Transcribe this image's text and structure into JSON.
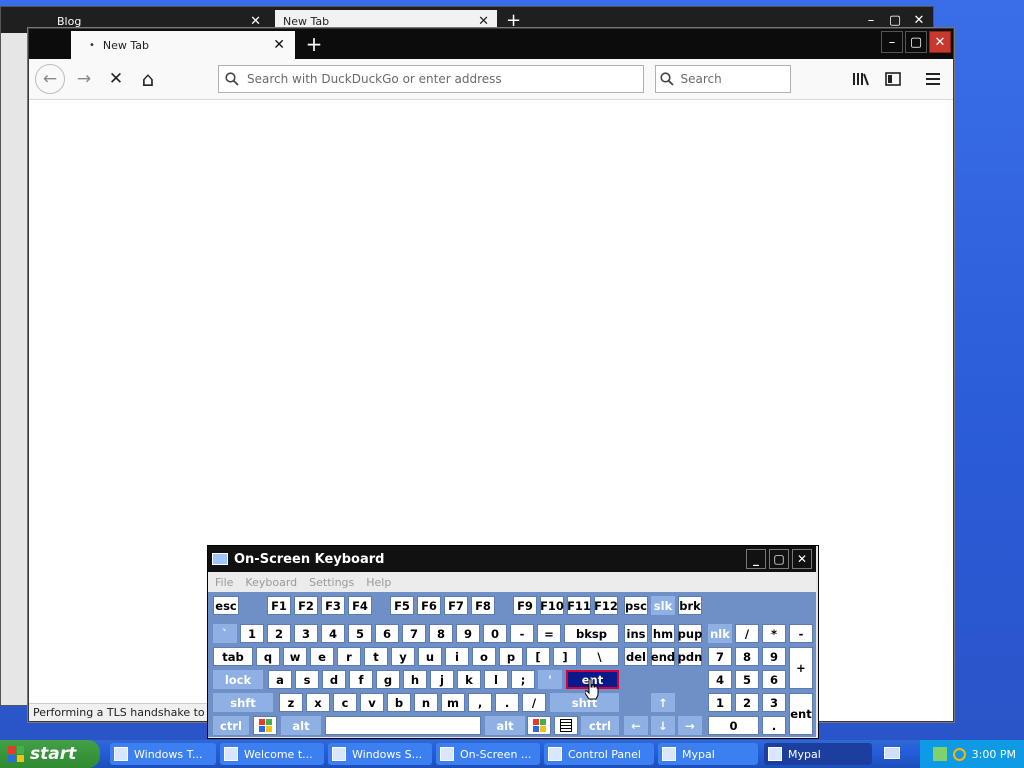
{
  "back_window": {
    "tabs": [
      {
        "label": "Blog",
        "close": "✕"
      },
      {
        "label": "New Tab",
        "close": "✕"
      }
    ],
    "new_tab": "+",
    "controls": [
      "–",
      "▢",
      "✕"
    ],
    "status": "Performing a TLS handshake to duck"
  },
  "browser": {
    "tab": {
      "label": "New Tab",
      "close": "✕"
    },
    "new_tab": "+",
    "controls": [
      "–",
      "▢",
      "✕"
    ],
    "toolbar": {
      "back": "←",
      "forward": "→",
      "stop": "✕",
      "home": "⌂",
      "url_placeholder": "Search with DuckDuckGo or enter address",
      "search_placeholder": "Search",
      "library": "|||\\",
      "sidebar": "▣",
      "menu": "≡"
    },
    "status": "Performing a TLS handshake to duck"
  },
  "osk": {
    "title": "On-Screen Keyboard",
    "menu": [
      "File",
      "Keyboard",
      "Settings",
      "Help"
    ],
    "controls": [
      "_",
      "▢",
      "✕"
    ],
    "keys": {
      "esc": "esc",
      "f1": "F1",
      "f2": "F2",
      "f3": "F3",
      "f4": "F4",
      "f5": "F5",
      "f6": "F6",
      "f7": "F7",
      "f8": "F8",
      "f9": "F9",
      "f10": "F10",
      "f11": "F11",
      "f12": "F12",
      "psc": "psc",
      "slk": "slk",
      "brk": "brk",
      "grave": "`",
      "n1": "1",
      "n2": "2",
      "n3": "3",
      "n4": "4",
      "n5": "5",
      "n6": "6",
      "n7": "7",
      "n8": "8",
      "n9": "9",
      "n0": "0",
      "minus": "-",
      "equals": "=",
      "bksp": "bksp",
      "ins": "ins",
      "hm": "hm",
      "pup": "pup",
      "nlk": "nlk",
      "kp_div": "/",
      "kp_mul": "*",
      "kp_sub": "-",
      "tab": "tab",
      "q": "q",
      "w": "w",
      "e": "e",
      "r": "r",
      "t": "t",
      "y": "y",
      "u": "u",
      "i": "i",
      "o": "o",
      "p": "p",
      "lbr": "[",
      "rbr": "]",
      "bslash": "\\",
      "del": "del",
      "end": "end",
      "pdn": "pdn",
      "kp7": "7",
      "kp8": "8",
      "kp9": "9",
      "kp_add": "+",
      "lock": "lock",
      "a": "a",
      "s": "s",
      "d": "d",
      "f": "f",
      "g": "g",
      "h": "h",
      "j": "j",
      "k": "k",
      "l": "l",
      "semi": ";",
      "quote": "'",
      "ent": "ent",
      "kp4": "4",
      "kp5": "5",
      "kp6": "6",
      "lshft": "shft",
      "z": "z",
      "x": "x",
      "c": "c",
      "v": "v",
      "b": "b",
      "n": "n",
      "m": "m",
      "comma": ",",
      "period": ".",
      "slash": "/",
      "rshft": "shft",
      "up": "↑",
      "kp1": "1",
      "kp2": "2",
      "kp3": "3",
      "kp_ent": "ent",
      "lctrl": "ctrl",
      "lalt": "alt",
      "space": "",
      "ralt": "alt",
      "rctrl": "ctrl",
      "left": "←",
      "down": "↓",
      "right": "→",
      "kp0": "0",
      "kp_dot": "."
    }
  },
  "taskbar": {
    "start": "start",
    "tasks": [
      "Windows T...",
      "Welcome t...",
      "Windows S...",
      "On-Screen ...",
      "Control Panel",
      "Mypal",
      "Mypal"
    ],
    "clock": "3:00 PM"
  }
}
